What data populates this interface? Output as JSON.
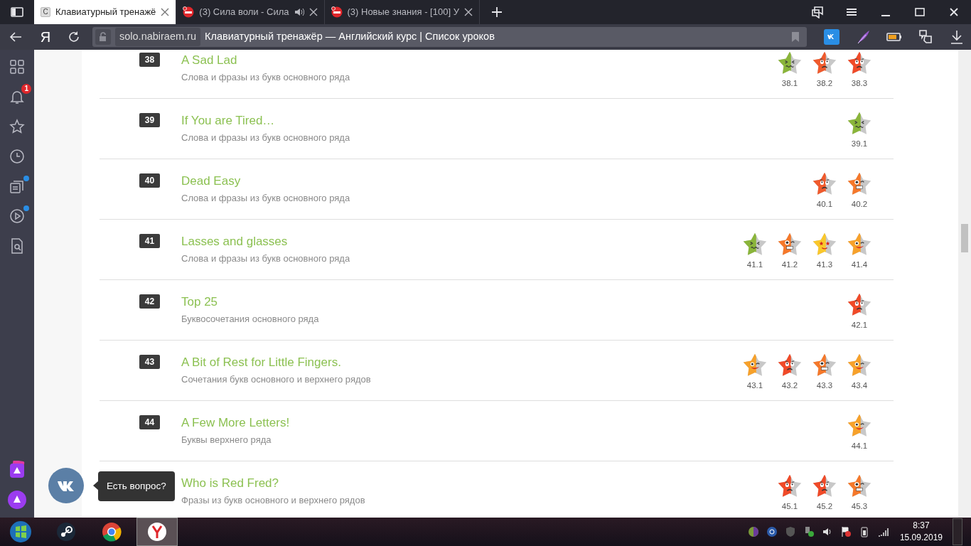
{
  "browser": {
    "tabs": [
      {
        "title": "Клавиатурный тренажё",
        "favicon": "С",
        "selected": true,
        "audio": false
      },
      {
        "title": "(3) Сила воли - Сила",
        "selected": false,
        "audio": true
      },
      {
        "title": "(3) Новые знания - [100] У",
        "selected": false,
        "audio": false
      }
    ],
    "logo": "Я",
    "address": {
      "domain": "solo.nabiraem.ru",
      "title": "Клавиатурный тренажёр — Английский курс | Список уроков"
    }
  },
  "sidebar": {
    "notifications": "1"
  },
  "lessons": [
    {
      "number": "38",
      "title": "A Sad Lad",
      "subtitle": "Слова и фразы из букв основного ряда",
      "stars": [
        {
          "label": "38.1",
          "kind": "wince",
          "color": "#8ab53a"
        },
        {
          "label": "38.2",
          "kind": "sad",
          "color": "#f05a2c"
        },
        {
          "label": "38.3",
          "kind": "sad",
          "color": "#f04a28"
        }
      ]
    },
    {
      "number": "39",
      "title": "If You are Tired…",
      "subtitle": "Слова и фразы из букв основного ряда",
      "stars": [
        {
          "label": "39.1",
          "kind": "wince",
          "color": "#8ab53a"
        }
      ]
    },
    {
      "number": "40",
      "title": "Dead Easy",
      "subtitle": "Слова и фразы из букв основного ряда",
      "stars": [
        {
          "label": "40.1",
          "kind": "sad",
          "color": "#f05a2c"
        },
        {
          "label": "40.2",
          "kind": "grimace",
          "color": "#f5782a"
        }
      ]
    },
    {
      "number": "41",
      "title": "Lasses and glasses",
      "subtitle": "Слова и фразы из букв основного ряда",
      "stars": [
        {
          "label": "41.1",
          "kind": "wince",
          "color": "#8ab53a"
        },
        {
          "label": "41.2",
          "kind": "grimace",
          "color": "#f5782a"
        },
        {
          "label": "41.3",
          "kind": "starry",
          "color": "#fac72a"
        },
        {
          "label": "41.4",
          "kind": "wink",
          "color": "#f7a12a"
        }
      ]
    },
    {
      "number": "42",
      "title": "Top 25",
      "subtitle": "Буквосочетания основного ряда",
      "stars": [
        {
          "label": "42.1",
          "kind": "sad",
          "color": "#f04a28"
        }
      ]
    },
    {
      "number": "43",
      "title": "A Bit of Rest for Little Fingers.",
      "subtitle": "Сочетания букв основного и верхнего рядов",
      "stars": [
        {
          "label": "43.1",
          "kind": "wink",
          "color": "#f7a12a"
        },
        {
          "label": "43.2",
          "kind": "sad",
          "color": "#f04a28"
        },
        {
          "label": "43.3",
          "kind": "grimace",
          "color": "#f5782a"
        },
        {
          "label": "43.4",
          "kind": "wink",
          "color": "#f7a12a"
        }
      ]
    },
    {
      "number": "44",
      "title": "A Few More Letters!",
      "subtitle": "Буквы верхнего ряда",
      "stars": [
        {
          "label": "44.1",
          "kind": "wink",
          "color": "#f7a12a"
        }
      ]
    },
    {
      "title": "Who is Red Fred?",
      "subtitle": "Фразы из букв основного и верхнего рядов",
      "stars": [
        {
          "label": "45.1",
          "kind": "sad",
          "color": "#f04a28"
        },
        {
          "label": "45.2",
          "kind": "sad",
          "color": "#f04a28"
        },
        {
          "label": "45.3",
          "kind": "grimace",
          "color": "#f5782a"
        }
      ]
    }
  ],
  "chat": {
    "tooltip": "Есть вопрос?"
  },
  "taskbar": {
    "time": "8:37",
    "date": "15.09.2019"
  }
}
